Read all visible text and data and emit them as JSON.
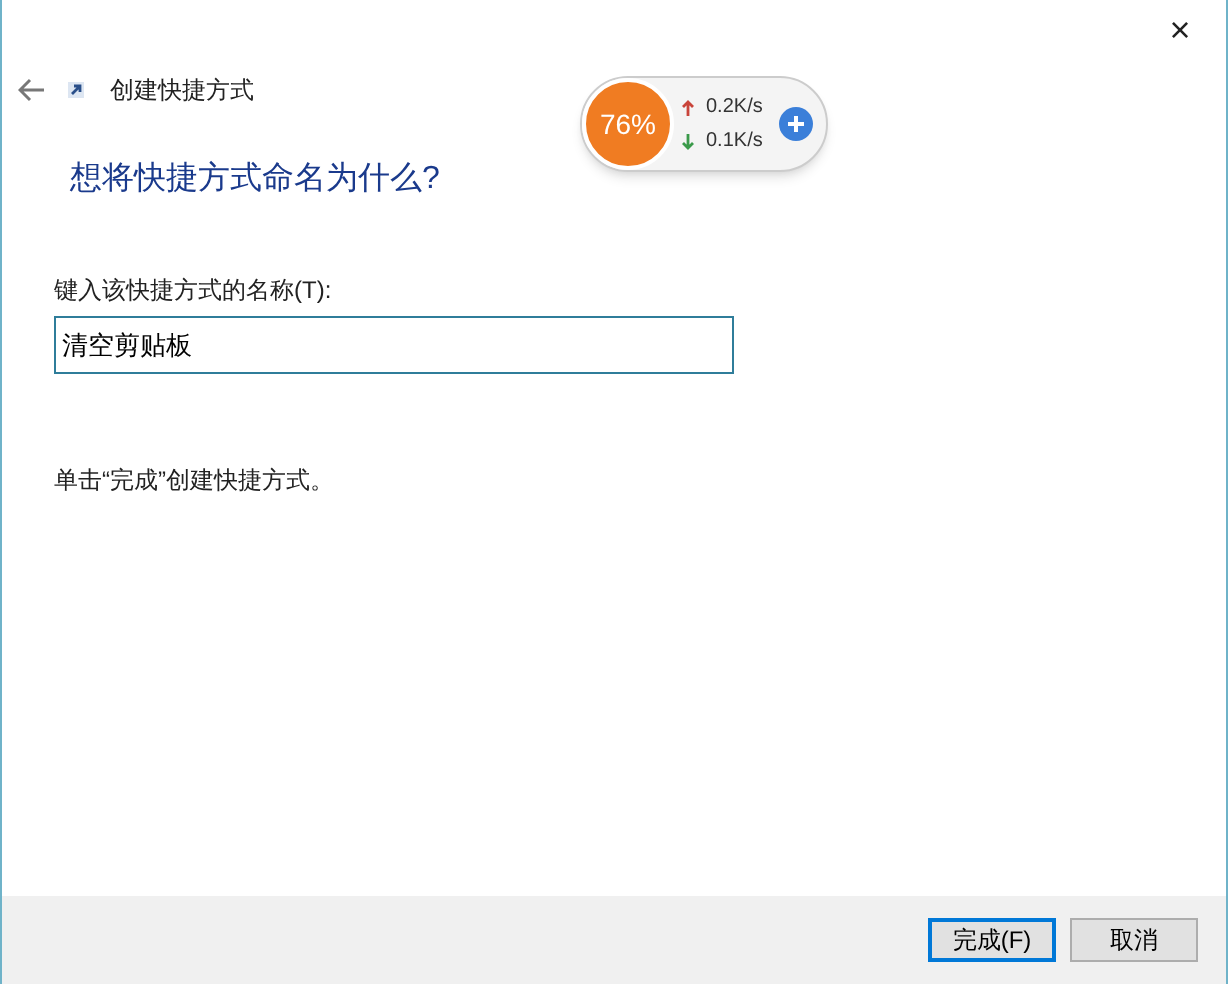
{
  "window": {
    "title": "创建快捷方式",
    "close": "×"
  },
  "heading": "想将快捷方式命名为什么?",
  "name_field": {
    "label": "键入该快捷方式的名称(T):",
    "value": "清空剪贴板"
  },
  "hint": "单击“完成”创建快捷方式。",
  "speed_widget": {
    "percent": "76%",
    "upload": "0.2K/s",
    "download": "0.1K/s"
  },
  "buttons": [
    {
      "label": "完成(F)",
      "default": true
    },
    {
      "label": "取消",
      "default": false
    }
  ]
}
